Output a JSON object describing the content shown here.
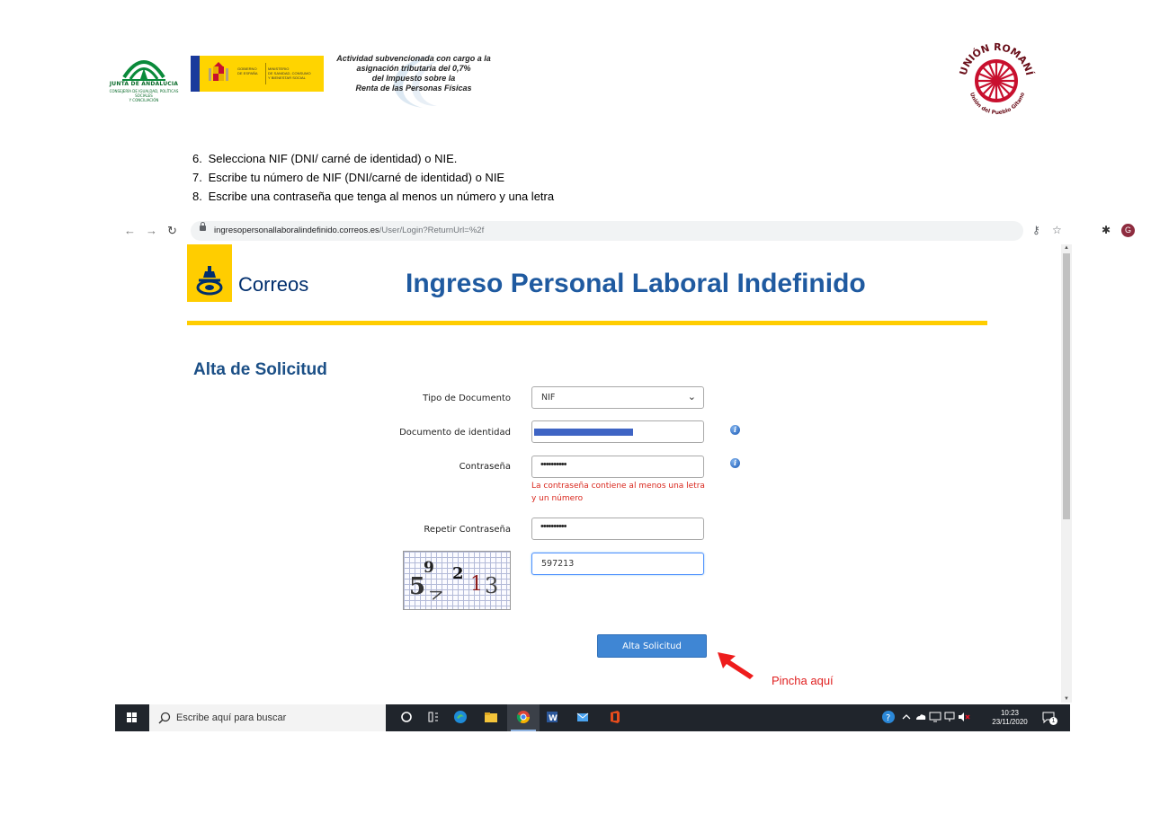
{
  "header": {
    "junta_label": "JUNTA DE ANDALUCIA",
    "junta_sub_1": "CONSEJERÍA DE IGUALDAD, POLÍTICAS SOCIALES",
    "junta_sub_2": "Y CONCILIACIÓN",
    "gobierno_1": "GOBIERNO",
    "gobierno_2": "DE ESPAÑA",
    "ministerio_1": "MINISTERIO",
    "ministerio_2": "DE SANIDAD, CONSUMO",
    "ministerio_3": "Y BIENESTAR SOCIAL",
    "irpf_line_1": "Actividad subvencionada con cargo a la",
    "irpf_line_2": "asignación tributaria del 0,7%",
    "irpf_line_3": "del Impuesto sobre la",
    "irpf_line_4": "Renta de las Personas Físicas",
    "union_top": "UNIÓN ROMANÍ",
    "union_bottom": "Unión del Pueblo Gitano"
  },
  "instructions": [
    {
      "num": "6.",
      "text": "Selecciona NIF (DNI/ carné de identidad) o NIE."
    },
    {
      "num": "7.",
      "text": "Escribe tu número de NIF (DNI/carné de identidad) o NIE"
    },
    {
      "num": "8.",
      "text": "Escribe una contraseña que tenga al menos un número y una letra"
    }
  ],
  "browser": {
    "url_host": "ingresopersonallaboralindefinido.correos.es",
    "url_path": "/User/Login?ReturnUrl=%2f",
    "avatar_letter": "G"
  },
  "site": {
    "brand": "Correos",
    "title": "Ingreso Personal Laboral Indefinido"
  },
  "form": {
    "title": "Alta de Solicitud",
    "tipo_label": "Tipo de Documento",
    "tipo_value": "NIF",
    "documento_label": "Documento de identidad",
    "password_label": "Contraseña",
    "password_dots": "••••••••••",
    "password_hint": "La contraseña contiene al menos una letra y un número",
    "repeat_label": "Repetir Contraseña",
    "repeat_dots": "••••••••••",
    "captcha_value": "597213",
    "submit_label": "Alta Solicitud"
  },
  "annotation": {
    "text": "Pincha aquí",
    "color": "#e02020"
  },
  "taskbar": {
    "search_placeholder": "Escribe aquí para buscar",
    "time": "10:23",
    "date": "23/11/2020",
    "notification_count": "1"
  },
  "colors": {
    "correos_yellow": "#ffcd00",
    "correos_blue": "#002e6d",
    "title_blue": "#1f5aa0",
    "button_blue": "#3f86d4",
    "hint_red": "#d9261c"
  }
}
